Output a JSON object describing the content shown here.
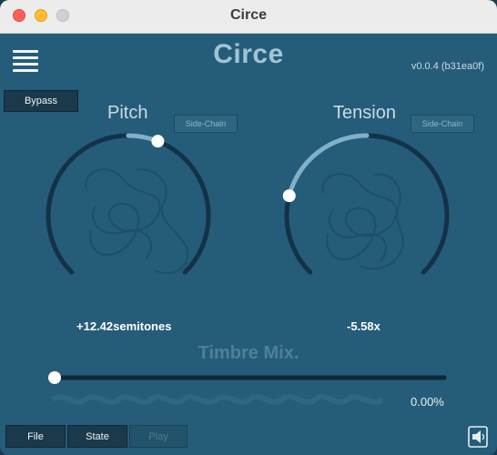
{
  "window": {
    "title": "Circe"
  },
  "header": {
    "title": "Circe",
    "version": "v0.0.4 (b31ea0f)"
  },
  "bypass": {
    "label": "Bypass"
  },
  "pitch": {
    "label": "Pitch",
    "sidechain_label": "Side-Chain",
    "value_text": "+12.42semitones",
    "level": 0.58
  },
  "tension": {
    "label": "Tension",
    "sidechain_label": "Side-Chain",
    "value_text": "-5.58x",
    "level": 0.22
  },
  "timbre_mix": {
    "label": "Timbre Mix.",
    "value_text": "0.00%",
    "level": 0.0
  },
  "footer": {
    "file_label": "File",
    "state_label": "State",
    "play_label": "Play"
  },
  "icons": {
    "menu": "hamburger-menu-icon",
    "export": "export-audio-icon"
  },
  "colors": {
    "panel": "#255c79",
    "arc_track": "#143247",
    "arc_fill": "#7fb1ca",
    "knob": "#ffffff"
  }
}
